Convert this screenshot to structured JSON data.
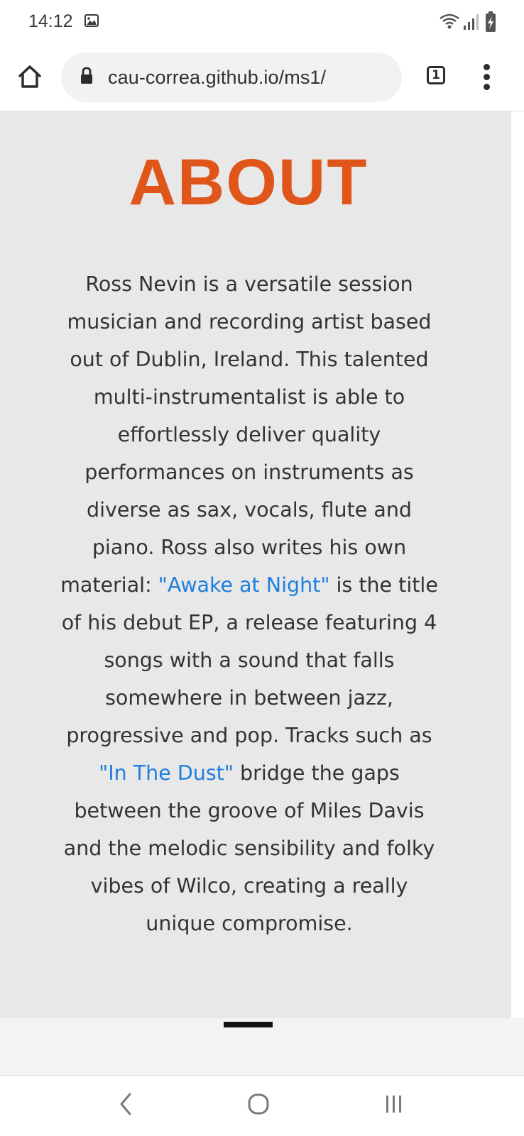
{
  "status_bar": {
    "time": "14:12",
    "icons": [
      "gallery-icon",
      "wifi-icon",
      "signal-icon",
      "battery-charging-icon"
    ]
  },
  "browser": {
    "url": "cau-correa.github.io/ms1/",
    "tab_count": "1",
    "icons": [
      "home-icon",
      "lock-icon",
      "tabs-icon",
      "more-vert-icon"
    ]
  },
  "about": {
    "title": "ABOUT",
    "intro": "Ross Nevin is a versatile session musician and recording artist based out of Dublin, Ireland. This talented multi-instrumentalist is able to effortlessly deliver quality performances on instruments as diverse as sax, vocals, flute and piano. Ross also writes his own material: ",
    "link_ep": "\"Awake at Night\"",
    "middle": " is the title of his debut EP, a release featuring 4 songs with a sound that falls somewhere in between jazz, progressive and pop. Tracks such as ",
    "link_track": "\"In The Dust\"",
    "ending": " bridge the gaps between the groove of Miles Davis and the melodic sensibility and folky vibes of Wilco, creating a really unique compromise."
  },
  "navigation": {
    "icons": [
      "back-icon",
      "home-circle-icon",
      "recents-icon"
    ]
  },
  "colors": {
    "title": "#e0561a",
    "link": "#1f7ede",
    "content_bg": "#e8e8e9",
    "body_text": "#333333"
  }
}
